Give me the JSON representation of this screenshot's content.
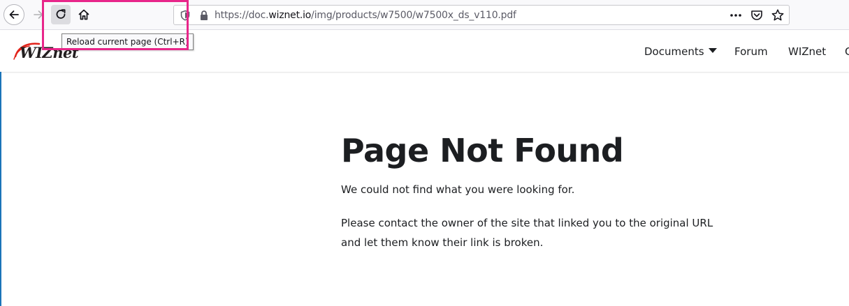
{
  "browser": {
    "url": {
      "prefix": "https://doc.",
      "host": "wiznet.io",
      "path": "/img/products/w7500/w7500x_ds_v110.pdf"
    },
    "tooltip": "Reload current page (Ctrl+R)",
    "icons": {
      "back": "back-arrow-icon",
      "forward": "forward-arrow-icon",
      "reload": "reload-icon",
      "home": "home-icon",
      "shield": "tracking-protection-shield-icon",
      "lock": "lock-icon",
      "more": "more-dots-icon",
      "pocket": "pocket-icon",
      "bookmark": "star-icon"
    },
    "highlight_color": "#e8268a"
  },
  "site": {
    "logo": "WIZnet",
    "nav": {
      "documents": "Documents",
      "forum": "Forum",
      "wiznet": "WIZnet",
      "overflow": "C"
    }
  },
  "content": {
    "title": "Page Not Found",
    "paragraph1": "We could not find what you were looking for.",
    "paragraph2": "Please contact the owner of the site that linked you to the original URL and let them know their link is broken."
  }
}
